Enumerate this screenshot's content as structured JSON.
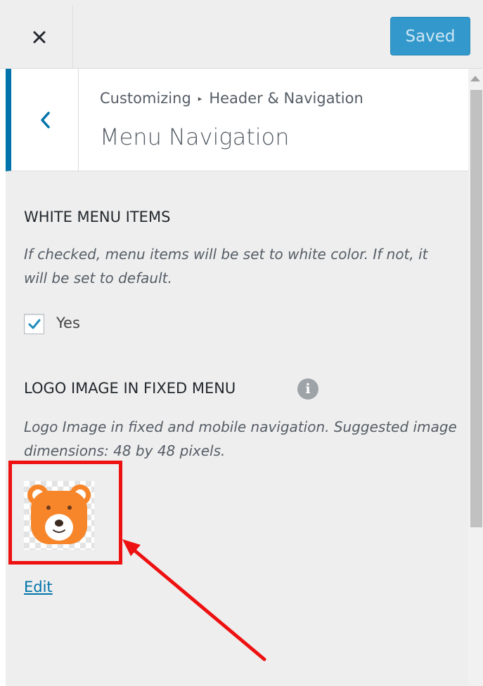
{
  "header": {
    "close_icon": "close-icon",
    "save_button": "Saved"
  },
  "section": {
    "back_icon": "chevron-left-icon",
    "breadcrumb_root": "Customizing",
    "breadcrumb_separator": "▸",
    "breadcrumb_parent": "Header & Navigation",
    "title": "Menu Navigation"
  },
  "controls": {
    "white_menu": {
      "title": "WHITE MENU ITEMS",
      "description": "If checked, menu items will be set to white color. If not, it will be set to default.",
      "checkbox_label": "Yes",
      "checked": true
    },
    "logo_fixed": {
      "title": "LOGO IMAGE IN FIXED MENU",
      "info_icon": "info-icon",
      "description": "Logo Image in fixed and mobile navigation. Suggested image dimensions: 48 by 48 pixels.",
      "image_icon": "bear-logo-icon",
      "edit_link": "Edit"
    }
  },
  "annotation": {
    "highlight_color": "#ee1111"
  },
  "colors": {
    "accent": "#0073aa",
    "button": "#3399cc",
    "bear": "#f7862a"
  }
}
